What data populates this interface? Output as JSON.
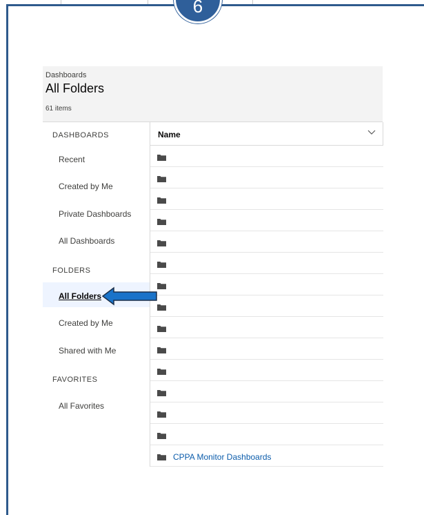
{
  "step_badge": {
    "number": "6"
  },
  "header": {
    "breadcrumb": "Dashboards",
    "title": "All Folders",
    "item_count": "61 items"
  },
  "sidebar": {
    "sections": [
      {
        "label": "DASHBOARDS",
        "items": [
          "Recent",
          "Created by Me",
          "Private Dashboards",
          "All Dashboards"
        ]
      },
      {
        "label": "FOLDERS",
        "items": [
          "All Folders",
          "Created by Me",
          "Shared with Me"
        ]
      },
      {
        "label": "FAVORITES",
        "items": [
          "All Favorites"
        ]
      }
    ],
    "active_item": "All Folders"
  },
  "table": {
    "column_header": "Name",
    "header_icon": "chevron-down-icon",
    "row_icon": "folder-icon",
    "rows": [
      "",
      "",
      "",
      "",
      "",
      "",
      "",
      "",
      "",
      "",
      "",
      "",
      "",
      "",
      "CPPA Monitor Dashboards"
    ]
  },
  "colors": {
    "frame_border": "#2e5a8c",
    "badge": "#2f5f9a",
    "link": "#0b5cab",
    "arrow": "#1a73c9"
  }
}
